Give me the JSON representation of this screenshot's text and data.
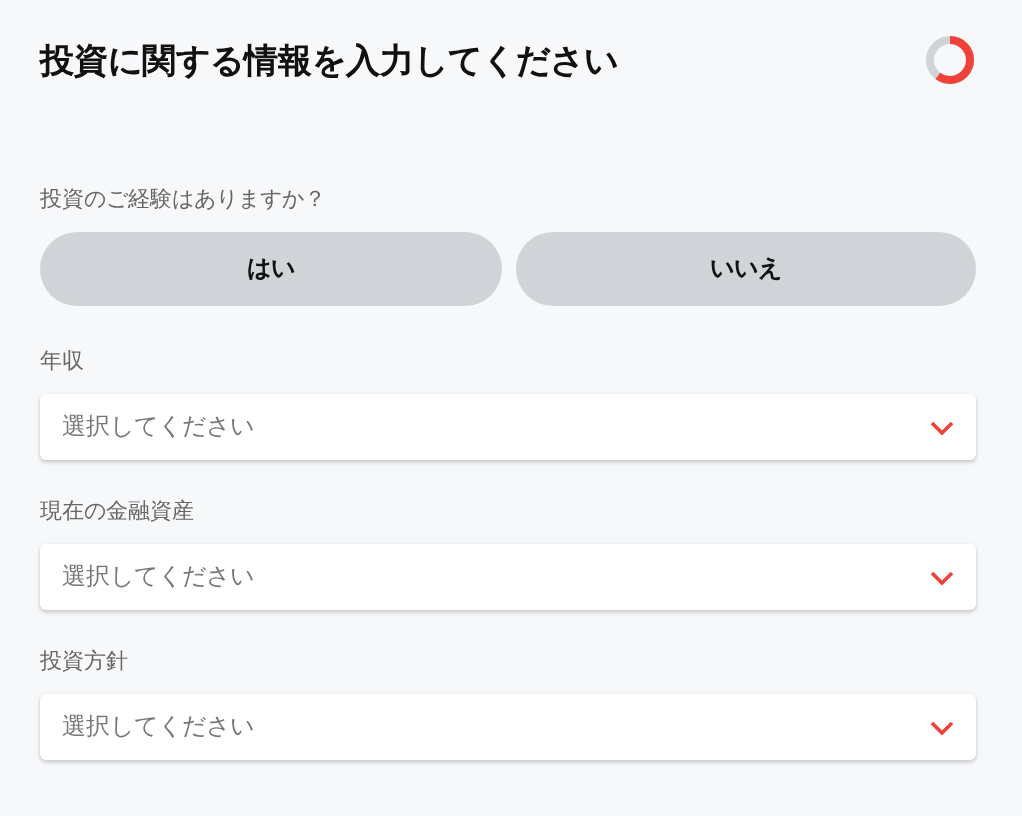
{
  "header": {
    "title": "投資に関する情報を入力してください",
    "progress": {
      "level": 0.6
    }
  },
  "experience": {
    "label": "投資のご経験はありますか？",
    "options": [
      {
        "label": "はい",
        "selected": false
      },
      {
        "label": "いいえ",
        "selected": false
      }
    ]
  },
  "fields": [
    {
      "label": "年収",
      "placeholder": "選択してください"
    },
    {
      "label": "現在の金融資産",
      "placeholder": "選択してください"
    },
    {
      "label": "投資方針",
      "placeholder": "選択してください"
    }
  ]
}
